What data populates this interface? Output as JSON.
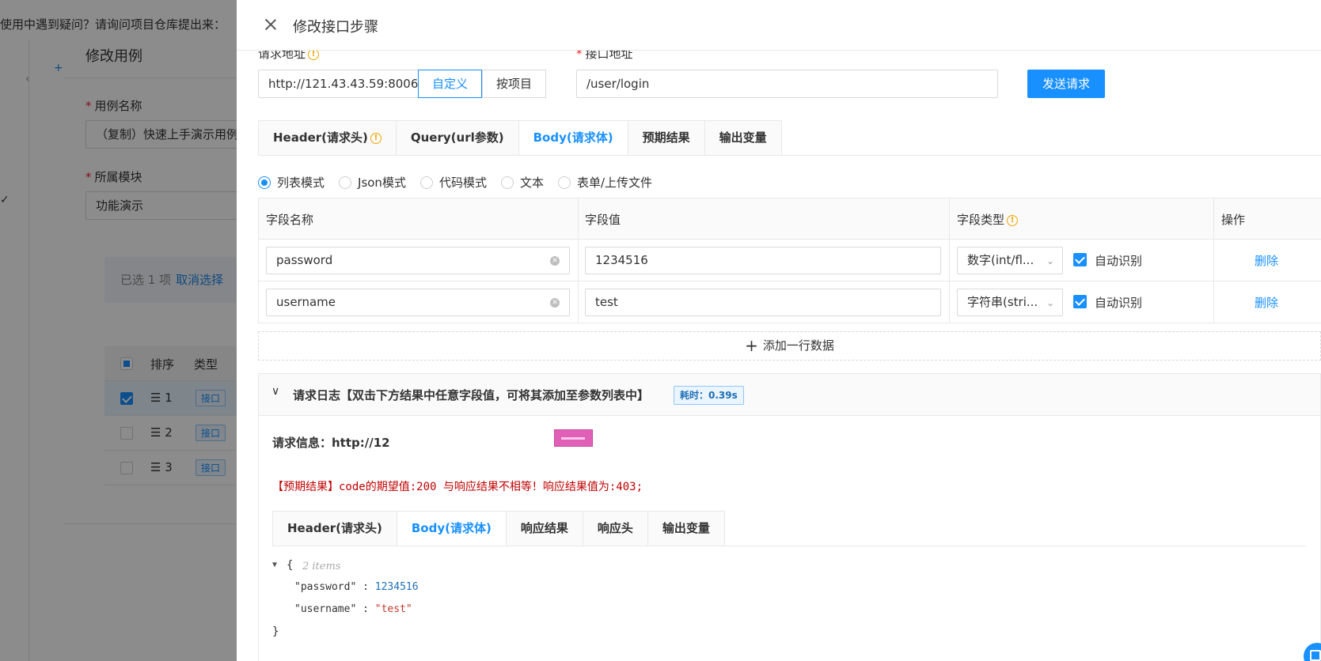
{
  "background": {
    "top_hint": "使用中遇到疑问？请询问项目仓库提出来：",
    "modal_title": "修改用例",
    "case_name_label": "用例名称",
    "case_name_value": "（复制）快速上手演示用例",
    "module_label": "所属模块",
    "module_value": "功能演示",
    "selected_text": "已选 1 项",
    "cancel_select": "取消选择",
    "table_headers": [
      "排序",
      "类型"
    ],
    "rows": [
      {
        "order": "☰ 1",
        "type": "接口",
        "checked": true
      },
      {
        "order": "☰ 2",
        "type": "接口",
        "checked": false
      },
      {
        "order": "☰ 3",
        "type": "接口",
        "checked": false
      }
    ]
  },
  "drawer": {
    "title": "修改接口步骤",
    "request_addr_label": "请求地址",
    "api_addr_label": "接口地址",
    "base_url": "http://121.43.43.59:8006",
    "mode_buttons": {
      "custom": "自定义",
      "by_project": "按项目"
    },
    "path": "/user/login",
    "send_button": "发送请求",
    "tabs": [
      "Header(请求头)",
      "Query(url参数)",
      "Body(请求体)",
      "预期结果",
      "输出变量"
    ],
    "active_tab": "Body(请求体)",
    "body_modes": [
      "列表模式",
      "Json模式",
      "代码模式",
      "文本",
      "表单/上传文件"
    ],
    "active_body_mode": "列表模式",
    "param_table": {
      "headers": [
        "字段名称",
        "字段值",
        "字段类型",
        "操作"
      ],
      "rows": [
        {
          "name": "password",
          "value": "1234516",
          "type": "数字(int/fl...",
          "auto_label": "自动识别",
          "action": "删除"
        },
        {
          "name": "username",
          "value": "test",
          "type": "字符串(stri...",
          "auto_label": "自动识别",
          "action": "删除"
        }
      ]
    },
    "add_row": "添加一行数据",
    "log": {
      "title": "请求日志【双击下方结果中任意字段值，可将其添加至参数列表中】",
      "time_badge": "耗时：0.39s",
      "request_info": "请求信息：http://12",
      "expect_warning": "【预期结果】code的期望值:200 与响应结果不相等！响应结果值为:403;",
      "result_tabs": [
        "Header(请求头)",
        "Body(请求体)",
        "响应结果",
        "响应头",
        "输出变量"
      ],
      "active_result_tab": "Body(请求体)",
      "json": {
        "items_hint": "2 items",
        "lines": [
          {
            "key": "\"password\"",
            "value": "1234516",
            "kind": "num"
          },
          {
            "key": "\"username\"",
            "value": "\"test\"",
            "kind": "str"
          }
        ]
      }
    }
  },
  "colors": {
    "accent": "#1890ff",
    "warning": "#c00000",
    "info": "#f0a500"
  }
}
